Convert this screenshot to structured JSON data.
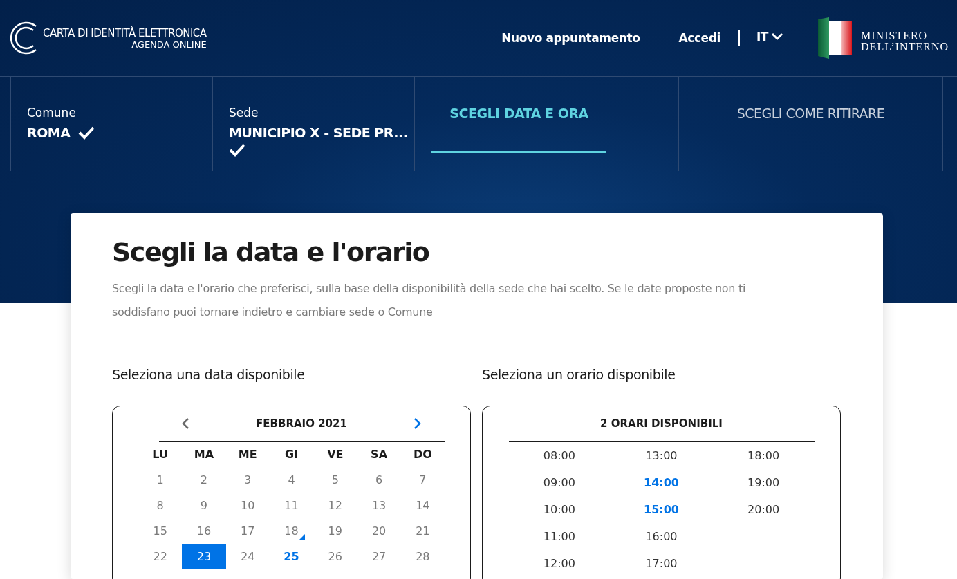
{
  "header": {
    "logo_title": "CARTA DI IDENTITÀ ELETTRONICA",
    "logo_subtitle": "AGENDA ONLINE",
    "nav": [
      "Nuovo appuntamento",
      "Accedi"
    ],
    "language": "IT",
    "ministry": [
      "MINISTERO",
      "DELL’INTERNO"
    ]
  },
  "steps": [
    {
      "kind": "done",
      "label": "Comune",
      "value": "ROMA"
    },
    {
      "kind": "done",
      "label": "Sede",
      "value": "MUNICIPIO X - SEDE PR..."
    },
    {
      "kind": "current",
      "title": "SCEGLI DATA E ORA"
    },
    {
      "kind": "todo",
      "title": "SCEGLI COME RITIRARE"
    }
  ],
  "page": {
    "title": "Scegli la data e l'orario",
    "description": "Scegli la data e l'orario che preferisci, sulla base della disponibilità della sede che hai scelto. Se le date proposte non ti soddisfano puoi tornare indietro e cambiare sede o Comune"
  },
  "date_section": {
    "heading": "Seleziona una data disponibile",
    "calendar": {
      "month": "FEBBRAIO 2021",
      "weekdays": [
        "LU",
        "MA",
        "ME",
        "GI",
        "VE",
        "SA",
        "DO"
      ],
      "days": [
        {
          "label": "1",
          "selected": false,
          "available": false,
          "today": false
        },
        {
          "label": "2",
          "selected": false,
          "available": false,
          "today": false
        },
        {
          "label": "3",
          "selected": false,
          "available": false,
          "today": false
        },
        {
          "label": "4",
          "selected": false,
          "available": false,
          "today": false
        },
        {
          "label": "5",
          "selected": false,
          "available": false,
          "today": false
        },
        {
          "label": "6",
          "selected": false,
          "available": false,
          "today": false
        },
        {
          "label": "7",
          "selected": false,
          "available": false,
          "today": false
        },
        {
          "label": "8",
          "selected": false,
          "available": false,
          "today": false
        },
        {
          "label": "9",
          "selected": false,
          "available": false,
          "today": false
        },
        {
          "label": "10",
          "selected": false,
          "available": false,
          "today": false
        },
        {
          "label": "11",
          "selected": false,
          "available": false,
          "today": false
        },
        {
          "label": "12",
          "selected": false,
          "available": false,
          "today": false
        },
        {
          "label": "13",
          "selected": false,
          "available": false,
          "today": false
        },
        {
          "label": "14",
          "selected": false,
          "available": false,
          "today": false
        },
        {
          "label": "15",
          "selected": false,
          "available": false,
          "today": false
        },
        {
          "label": "16",
          "selected": false,
          "available": false,
          "today": false
        },
        {
          "label": "17",
          "selected": false,
          "available": false,
          "today": false
        },
        {
          "label": "18",
          "selected": false,
          "available": false,
          "today": true
        },
        {
          "label": "19",
          "selected": false,
          "available": false,
          "today": false
        },
        {
          "label": "20",
          "selected": false,
          "available": false,
          "today": false
        },
        {
          "label": "21",
          "selected": false,
          "available": false,
          "today": false
        },
        {
          "label": "22",
          "selected": false,
          "available": false,
          "today": false
        },
        {
          "label": "23",
          "selected": true,
          "available": false,
          "today": false
        },
        {
          "label": "24",
          "selected": false,
          "available": false,
          "today": false
        },
        {
          "label": "25",
          "selected": false,
          "available": true,
          "today": false
        },
        {
          "label": "26",
          "selected": false,
          "available": false,
          "today": false
        },
        {
          "label": "27",
          "selected": false,
          "available": false,
          "today": false
        },
        {
          "label": "28",
          "selected": false,
          "available": false,
          "today": false
        }
      ]
    }
  },
  "time_section": {
    "heading": "Seleziona un orario disponibile",
    "count_title": "2 ORARI DISPONIBILI",
    "slots": [
      {
        "time": "08:00",
        "available": false
      },
      {
        "time": "09:00",
        "available": false
      },
      {
        "time": "10:00",
        "available": false
      },
      {
        "time": "11:00",
        "available": false
      },
      {
        "time": "12:00",
        "available": false
      },
      {
        "time": "13:00",
        "available": false
      },
      {
        "time": "14:00",
        "available": true
      },
      {
        "time": "15:00",
        "available": true
      },
      {
        "time": "16:00",
        "available": false
      },
      {
        "time": "17:00",
        "available": false
      },
      {
        "time": "18:00",
        "available": false
      },
      {
        "time": "19:00",
        "available": false
      },
      {
        "time": "20:00",
        "available": false
      }
    ]
  }
}
